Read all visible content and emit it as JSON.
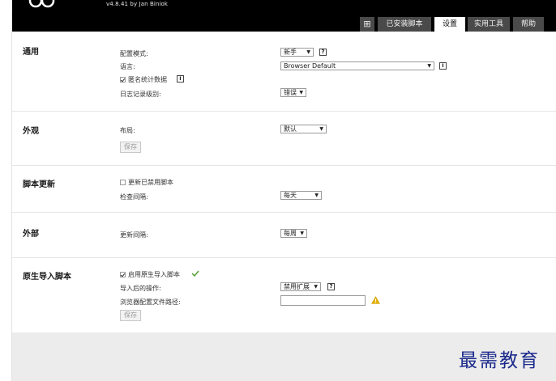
{
  "header": {
    "version": "v4.8.41 by Jan Biniok",
    "tabs": [
      {
        "label": "⊞",
        "icon": "add-script-icon"
      },
      {
        "label": "已安装脚本"
      },
      {
        "label": "设置",
        "active": true
      },
      {
        "label": "实用工具"
      },
      {
        "label": "帮助"
      }
    ]
  },
  "sections": {
    "general": {
      "title": "通用",
      "config_mode_label": "配置模式:",
      "config_mode_value": "新手",
      "language_label": "语言:",
      "language_value": "Browser Default",
      "anon_stats_label": "匿名统计数据",
      "anon_stats_checked": true,
      "log_level_label": "日志记录级别:",
      "log_level_value": "错误"
    },
    "appearance": {
      "title": "外观",
      "layout_label": "布局:",
      "layout_value": "默认",
      "save_label": "保存"
    },
    "script_update": {
      "title": "脚本更新",
      "update_disabled_label": "更新已禁用脚本",
      "update_disabled_checked": false,
      "check_interval_label": "检查间隔:",
      "check_interval_value": "每天"
    },
    "external": {
      "title": "外部",
      "update_interval_label": "更新间隔:",
      "update_interval_value": "每周"
    },
    "native_import": {
      "title": "原生导入脚本",
      "enable_label": "启用原生导入脚本",
      "enable_checked": true,
      "after_import_label": "导入后的操作:",
      "after_import_value": "禁用扩展",
      "profile_path_label": "浏览器配置文件路径:",
      "profile_path_value": "",
      "save_label": "保存"
    }
  },
  "watermark": "最需教育",
  "colors": {
    "header_bg": "#000000",
    "tab_bg": "#4a4a4a",
    "tab_active_bg": "#ffffff",
    "footer_bg": "#ececec",
    "check_green": "#4e9a2a",
    "warn_yellow": "#e8b400",
    "watermark": "#1b2a8c"
  }
}
